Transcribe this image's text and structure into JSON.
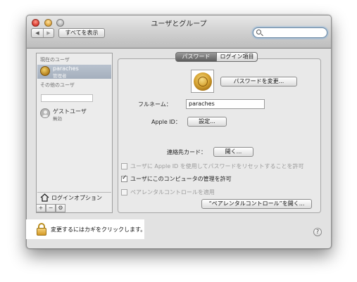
{
  "window": {
    "title": "ユーザとグループ"
  },
  "toolbar": {
    "back_glyph": "◀",
    "forward_glyph": "▶",
    "show_all_label": "すべてを表示",
    "search_value": ""
  },
  "sidebar": {
    "current_users_header": "現在のユーザ",
    "current_user": {
      "name": "paraches",
      "role": "管理者"
    },
    "other_users_header": "その他のユーザ",
    "guest": {
      "name": "ゲストユーザ",
      "status": "無効"
    },
    "login_options_label": "ログインオプション",
    "buttons": {
      "add": "+",
      "remove": "−",
      "action": "⚙"
    }
  },
  "tabs": [
    {
      "label": "パスワード",
      "active": true
    },
    {
      "label": "ログイン項目",
      "active": false
    }
  ],
  "password_tab": {
    "change_password_button": "パスワードを変更...",
    "full_name_label": "フルネーム：",
    "full_name_value": "paraches",
    "apple_id_label": "Apple ID：",
    "apple_id_button": "設定...",
    "contacts_card_label": "連絡先カード：",
    "contacts_card_button": "開く...",
    "checkboxes": [
      {
        "label": "ユーザに Apple ID を使用してパスワードをリセットすることを許可",
        "checked": false,
        "enabled": false
      },
      {
        "label": "ユーザにこのコンピュータの管理を許可",
        "checked": true,
        "enabled": true
      },
      {
        "label": "ペアレンタルコントロールを適用",
        "checked": false,
        "enabled": false
      }
    ],
    "parental_controls_button": "“ペアレンタルコントロール”を開く..."
  },
  "help_label": "?",
  "lock": {
    "text": "変更するにはカギをクリックします。",
    "icon": "lock-icon"
  }
}
